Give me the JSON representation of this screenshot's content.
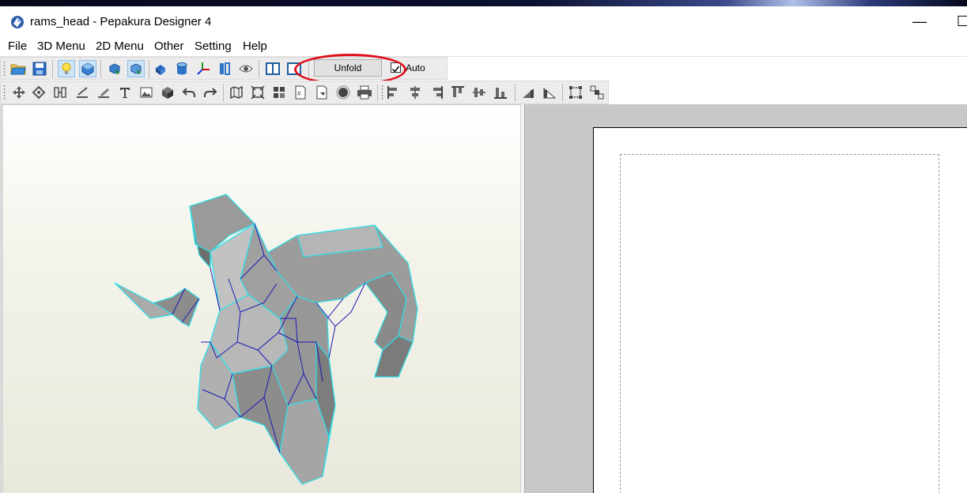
{
  "window": {
    "title": "rams_head - Pepakura Designer 4",
    "minimize_glyph": "—",
    "maximize_glyph": "☐"
  },
  "menu": [
    "File",
    "3D Menu",
    "2D Menu",
    "Other",
    "Setting",
    "Help"
  ],
  "toolbar1": {
    "icons": [
      "open-folder-icon",
      "save-icon",
      "light-bulb-icon",
      "texture-display-icon",
      "select-faces-icon",
      "select-edges-icon",
      "paint-bucket-icon",
      "cylinder-icon",
      "axes-icon",
      "parallel-view-icon",
      "eye-view-icon",
      "split-view-icon",
      "single-view-icon"
    ],
    "unfold_label": "Unfold",
    "auto_label": "Auto",
    "auto_checked": true
  },
  "toolbar2": {
    "icons": [
      "move-parts-icon",
      "rotate-parts-icon",
      "join-edges-icon",
      "line-tool-icon",
      "fold-line-icon",
      "text-tool-icon",
      "image-tool-icon",
      "box-icon",
      "undo-icon",
      "redo-icon",
      "map-icon",
      "fit-page-icon",
      "arrange-grid-icon",
      "number-page-icon",
      "flap-icon",
      "circle-icon",
      "print-icon",
      "align-left-icon",
      "align-center-icon",
      "align-right-icon",
      "align-top-icon",
      "align-middle-icon",
      "align-bottom-icon",
      "rotate-left-icon",
      "rotate-right-icon",
      "group-icon",
      "ungroup-icon"
    ]
  },
  "colors": {
    "accent": "#1e7bd6",
    "highlight_circle": "#e0101c",
    "model_fill": "#9b9b9b",
    "model_edges": "#2de0e8",
    "fold_lines": "#1a1ab4"
  }
}
